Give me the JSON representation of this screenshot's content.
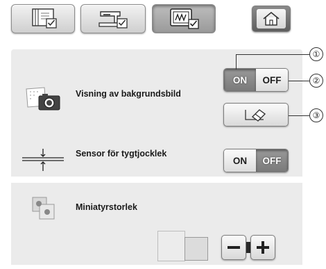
{
  "tabs": [
    {
      "icon": "page-settings-icon",
      "active": false
    },
    {
      "icon": "sewing-machine-settings-icon",
      "active": false
    },
    {
      "icon": "embroidery-settings-icon",
      "active": true
    }
  ],
  "home": {
    "icon": "home-icon"
  },
  "settings": {
    "background_image": {
      "label": "Visning av bakgrundsbild",
      "toggle": {
        "on": "ON",
        "off": "OFF",
        "selected": "ON"
      },
      "erase_icon": "eraser-icon"
    },
    "thickness_sensor": {
      "label": "Sensor för tygtjocklek",
      "toggle": {
        "on": "ON",
        "off": "OFF",
        "selected": "OFF"
      }
    },
    "thumbnail_size": {
      "label": "Miniatyrstorlek",
      "minus": "−",
      "plus": "+"
    }
  },
  "callouts": [
    "①",
    "②",
    "③"
  ]
}
